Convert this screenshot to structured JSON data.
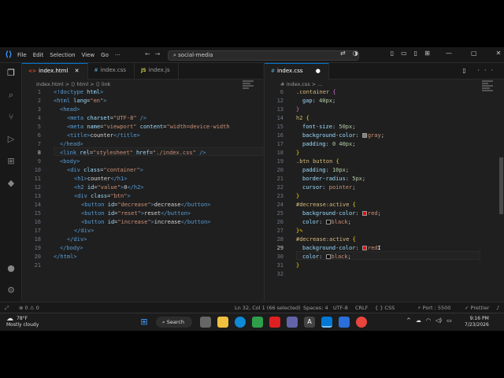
{
  "menu": [
    "File",
    "Edit",
    "Selection",
    "View",
    "Go"
  ],
  "search": {
    "text": "social-media"
  },
  "left_tabs": [
    {
      "ext": "<>",
      "name": "index.html",
      "color": "#e44d26"
    },
    {
      "ext": "#",
      "name": "index.css",
      "color": "#519aba"
    },
    {
      "ext": "JS",
      "name": "index.js",
      "color": "#cbcb41"
    }
  ],
  "right_tabs": [
    {
      "ext": "#",
      "name": "index.css",
      "dot": "●"
    }
  ],
  "left_breadcrumb": "index.html  >  ⟨⟩ html  >  ⟨⟩ link",
  "right_breadcrumb": "# index.css  >  ...",
  "left_lines": [
    "1",
    "2",
    "3",
    "4",
    "5",
    "6",
    "7",
    "8",
    "9",
    "10",
    "11",
    "12",
    "13",
    "14",
    "15",
    "16",
    "17",
    "18",
    "19",
    "20",
    "21"
  ],
  "right_lines": [
    "6",
    "12",
    "13",
    "14",
    "15",
    "16",
    "17",
    "18",
    "19",
    "20",
    "21",
    "22",
    "23",
    "24",
    "25",
    "26",
    "27",
    "28",
    "29",
    "30",
    "31",
    "32"
  ],
  "css_colors": {
    "gray": "#808080",
    "red": "#ff0000",
    "black": "#000000"
  },
  "status": {
    "errors": "⊗ 0  ⚠ 0",
    "position": "Ln 32, Col 1 (66 selected)",
    "spaces": "Spaces: 4",
    "encoding": "UTF-8",
    "eol": "CRLF",
    "language": "{ } CSS",
    "port": "⚡ Port : 5500",
    "prettier": "✓ Prettier"
  },
  "weather": {
    "temp": "78°F",
    "desc": "Mostly cloudy"
  },
  "taskbar_search": "Search",
  "clock": {
    "time": "9:16 PM",
    "date": "7/23/2026"
  }
}
